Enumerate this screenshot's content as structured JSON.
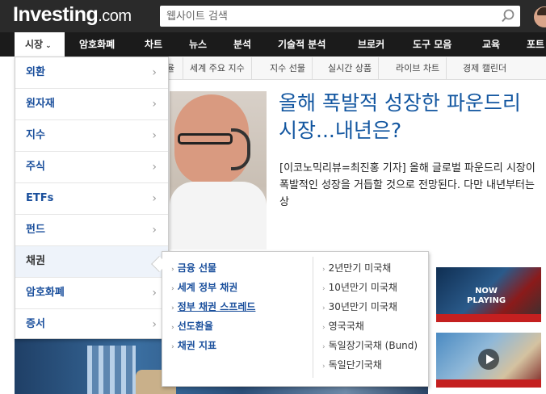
{
  "header": {
    "logo_main": "Investing",
    "logo_suffix": ".com",
    "search_placeholder": "웹사이트 검색"
  },
  "nav": {
    "markets": "시장",
    "caret": "⌄",
    "items": [
      "암호화폐",
      "차트",
      "뉴스",
      "분석",
      "기술적 분석",
      "브로커",
      "도구 모음",
      "교육",
      "포트"
    ]
  },
  "subnav": {
    "partial": "율",
    "items": [
      "세계 주요 지수",
      "지수 선물",
      "실시간 상품",
      "라이브 차트",
      "경제 캘린더"
    ]
  },
  "article": {
    "headline": "올해 폭발적 성장한 파운드리 시장...내년은?",
    "summary": "[이코노믹리뷰=최진홍 기자] 올해 글로벌 파운드리 시장이 폭발적인 성장을 거듭할 것으로 전망된다. 다만 내년부터는 상"
  },
  "dropdown": {
    "items": [
      "외환",
      "원자재",
      "지수",
      "주식",
      "ETFs",
      "펀드",
      "채권",
      "암호화폐",
      "증서"
    ],
    "chevron": "›"
  },
  "flyout": {
    "arrow": "›",
    "left": [
      "금융 선물",
      "세계 정부 채권",
      "정부 채권 스프레드",
      "선도환율",
      "채권 지표"
    ],
    "right": [
      "2년만기 미국채",
      "10년만기 미국채",
      "30년만기 미국채",
      "영국국채",
      "독일장기국채 (Bund)",
      "독일단기국채"
    ]
  },
  "video": {
    "now_playing_1": "NOW",
    "now_playing_2": "PLAYING"
  }
}
